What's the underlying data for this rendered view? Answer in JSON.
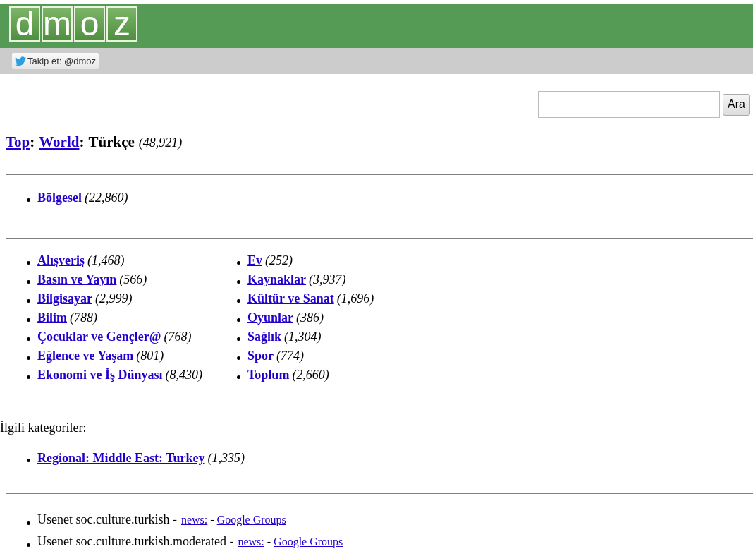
{
  "logo": {
    "letters": [
      "d",
      "m",
      "o",
      "z"
    ]
  },
  "follow_button": {
    "label": "Takip et: @dmoz"
  },
  "search": {
    "button": "Ara"
  },
  "breadcrumb": {
    "separator": ":",
    "links": [
      "Top",
      "World"
    ],
    "current": "Türkçe",
    "count": "(48,921)"
  },
  "regional": [
    {
      "label": "Bölgesel",
      "count": "(22,860)"
    }
  ],
  "categories": [
    [
      {
        "label": "Alışveriş",
        "count": "(1,468)"
      },
      {
        "label": "Basın ve Yayın",
        "count": "(566)"
      },
      {
        "label": "Bilgisayar",
        "count": "(2,999)"
      },
      {
        "label": "Bilim",
        "count": "(788)"
      },
      {
        "label": "Çocuklar ve Gençler@",
        "count": "(768)"
      },
      {
        "label": "Eğlence ve Yaşam",
        "count": "(801)"
      },
      {
        "label": "Ekonomi ve İş Dünyası",
        "count": "(8,430)"
      }
    ],
    [
      {
        "label": "Ev",
        "count": "(252)"
      },
      {
        "label": "Kaynaklar",
        "count": "(3,937)"
      },
      {
        "label": "Kültür ve Sanat",
        "count": "(1,696)"
      },
      {
        "label": "Oyunlar",
        "count": "(386)"
      },
      {
        "label": "Sağlık",
        "count": "(1,304)"
      },
      {
        "label": "Spor",
        "count": "(774)"
      },
      {
        "label": "Toplum",
        "count": "(2,660)"
      }
    ]
  ],
  "related": {
    "heading": "İlgili kategoriler:",
    "items": [
      {
        "label": "Regional: Middle East: Turkey",
        "count": "(1,335)"
      }
    ]
  },
  "newsgroups": [
    {
      "text": "Usenet soc.culture.turkish -",
      "news": "news:",
      "sep": "-",
      "groups": "Google Groups"
    },
    {
      "text": "Usenet soc.culture.turkish.moderated -",
      "news": "news:",
      "sep": "-",
      "groups": "Google Groups"
    }
  ]
}
